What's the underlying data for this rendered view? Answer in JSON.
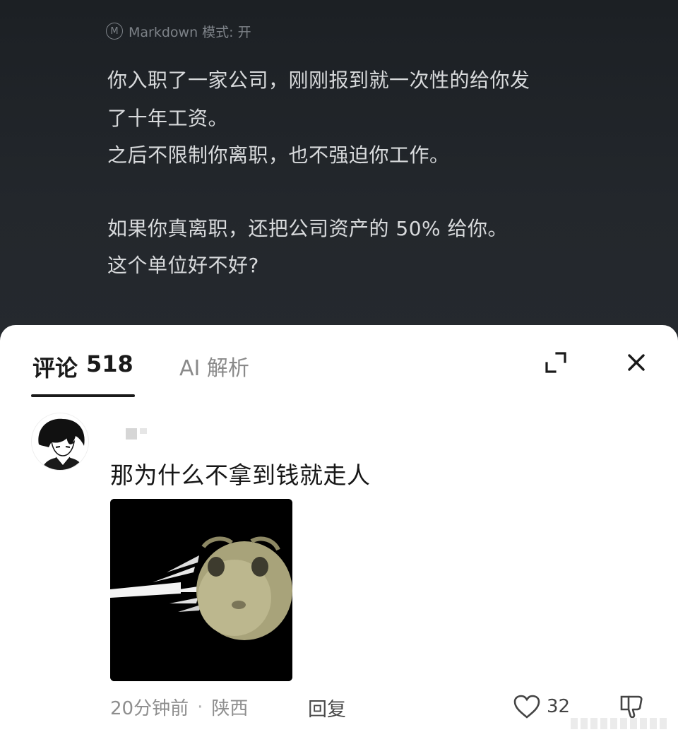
{
  "post": {
    "markdown_mode": "Markdown 模式: 开",
    "lines": [
      "你入职了一家公司，刚刚报到就一次性的给你发",
      "了十年工资。",
      "之后不限制你离职，也不强迫你工作。",
      "",
      "如果你真离职，还把公司资产的 50% 给你。",
      "这个单位好不好?"
    ]
  },
  "sheet": {
    "tabs": [
      {
        "label": "评论",
        "count": "518",
        "active": true
      },
      {
        "label": "AI 解析",
        "active": false
      }
    ],
    "icons": {
      "expand": "expand-icon",
      "close": "close-icon"
    }
  },
  "comment": {
    "avatar": "anime-avatar",
    "text": "那为什么不拿到钱就走人",
    "image": "hamster-sticker",
    "time": "20分钟前",
    "location": "陕西",
    "reply_label": "回复",
    "likes": "32"
  },
  "colors": {
    "post_bg": "#202428",
    "post_text": "#d8dadc",
    "sheet_bg": "#ffffff",
    "meta_text": "#8e8e8e"
  }
}
